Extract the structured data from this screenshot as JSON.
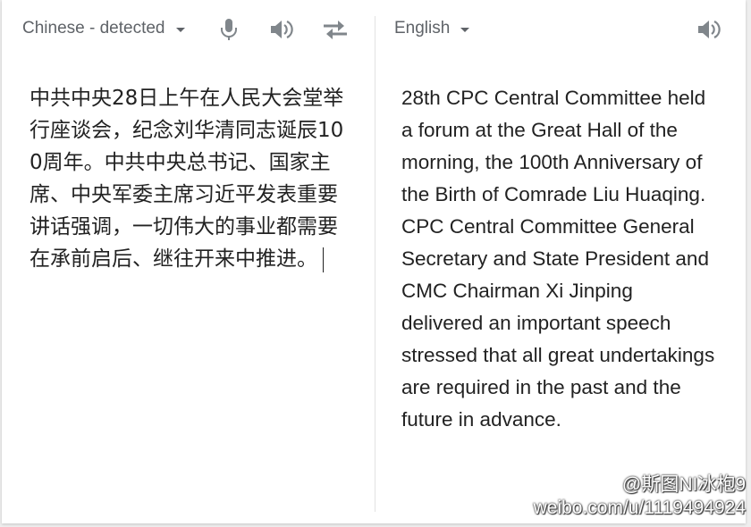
{
  "source_panel": {
    "language_label": "Chinese - detected",
    "icons": [
      "caret-down-icon",
      "microphone-icon",
      "speaker-icon",
      "swap-languages-icon"
    ],
    "text": "中共中央28日上午在人民大会堂举行座谈会，纪念刘华清同志诞辰100周年。中共中央总书记、国家主席、中央军委主席习近平发表重要讲话强调，一切伟大的事业都需要在承前启后、继往开来中推进。"
  },
  "target_panel": {
    "language_label": "English",
    "icons": [
      "caret-down-icon",
      "speaker-icon"
    ],
    "text": "28th CPC Central Committee held a forum at the Great Hall of the morning, the 100th Anniversary of the Birth of Comrade Liu Huaqing. CPC Central Committee General Secretary and State President and CMC Chairman Xi Jinping delivered an important speech stressed that all great undertakings are required in the past and the future in advance."
  },
  "watermark": {
    "handle": "@斯图NI冰枹9",
    "url": "weibo.com/u/1119494924"
  },
  "colors": {
    "icon_gray": "#5f6368",
    "text": "#222222",
    "background": "#ffffff"
  }
}
